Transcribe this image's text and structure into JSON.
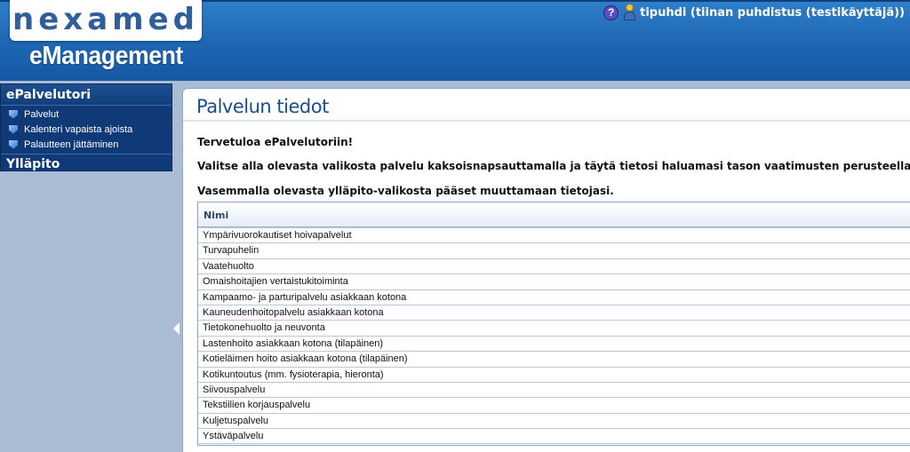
{
  "header": {
    "logo_text": "nexamed",
    "app_title": "eManagement",
    "user_label": "tipuhdi (tiinan puhdistus (testikäyttäjä))"
  },
  "icons": {
    "help": "help-icon",
    "user": "user-icon",
    "bullet": "bullet-icon",
    "collapse": "collapse-arrow-icon"
  },
  "sidebar": {
    "section_title": "ePalvelutori",
    "items": [
      {
        "label": "Palvelut"
      },
      {
        "label": "Kalenteri vapaista ajoista"
      },
      {
        "label": "Palautteen jättäminen"
      }
    ],
    "admin_title": "Ylläpito"
  },
  "main": {
    "title": "Palvelun tiedot",
    "welcome": "Tervetuloa ePalvelutoriin!",
    "instruction": "Valitse alla olevasta valikosta palvelu kaksoisnapsauttamalla ja täytä tietosi haluamasi tason vaatimusten perusteella.",
    "admin_hint": "Vasemmalla olevasta ylläpito-valikosta pääset muuttamaan tietojasi.",
    "grid": {
      "column_header": "Nimi",
      "rows": [
        "Ympärivuorokautiset hoivapalvelut",
        "Turvapuhelin",
        "Vaatehuolto",
        "Omaishoitajien vertaistukitoiminta",
        "Kampaamo- ja parturipalvelu asiakkaan kotona",
        "Kauneudenhoitopalvelu asiakkaan kotona",
        "Tietokonehuolto ja neuvonta",
        "Lastenhoito asiakkaan kotona (tilapäinen)",
        "Kotieläimen hoito asiakkaan kotona (tilapäinen)",
        "Kotikuntoutus (mm. fysioterapia, hieronta)",
        "Siivouspalvelu",
        "Tekstiilien korjauspalvelu",
        "Kuljetuspalvelu",
        "Ystäväpalvelu"
      ]
    }
  }
}
